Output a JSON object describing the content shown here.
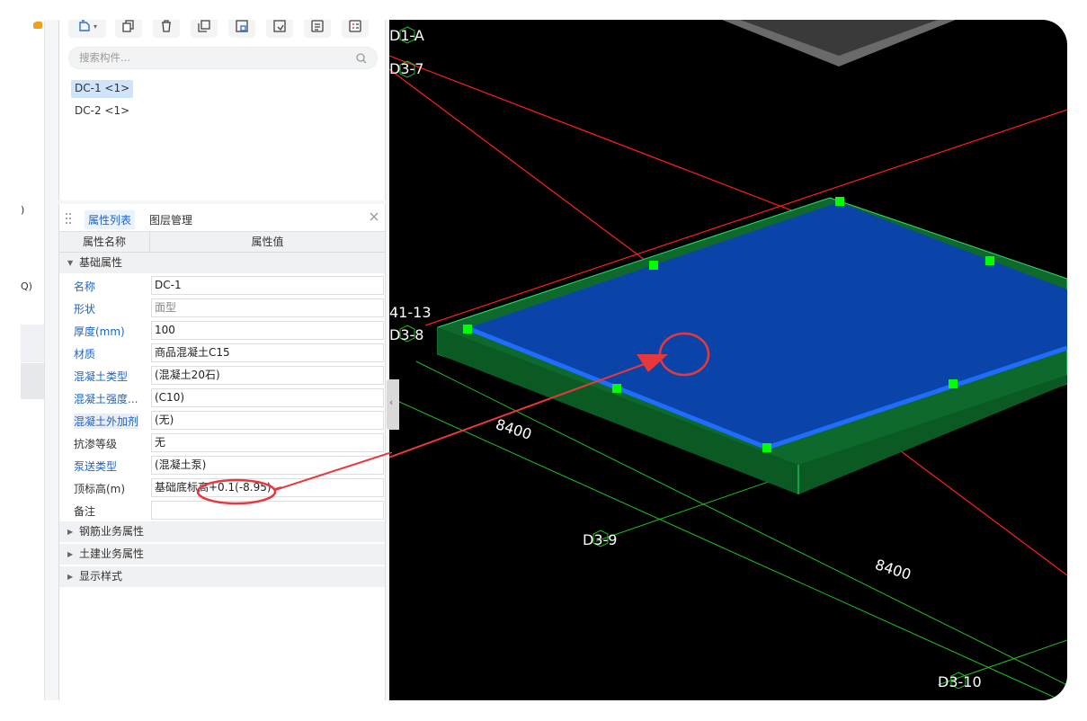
{
  "toolbar": {
    "buttons": [
      {
        "name": "new-component-icon"
      },
      {
        "name": "copy-icon"
      },
      {
        "name": "delete-icon"
      },
      {
        "name": "duplicate-icon"
      },
      {
        "name": "save-icon"
      },
      {
        "name": "export-icon"
      },
      {
        "name": "list-icon"
      },
      {
        "name": "checklist-icon"
      }
    ]
  },
  "search": {
    "placeholder": "搜索构件..."
  },
  "components": [
    {
      "label": "DC-1 <1>",
      "selected": true
    },
    {
      "label": "DC-2 <1>",
      "selected": false
    }
  ],
  "left_fragments": [
    ")",
    "Q)"
  ],
  "property_panel": {
    "tabs": [
      "属性列表",
      "图层管理"
    ],
    "header": {
      "name_col": "属性名称",
      "value_col": "属性值"
    },
    "group_basic": "基础属性",
    "rows": [
      {
        "name": "名称",
        "value": "DC-1"
      },
      {
        "name": "形状",
        "value": "面型"
      },
      {
        "name": "厚度(mm)",
        "value": "100"
      },
      {
        "name": "材质",
        "value": "商品混凝土C15"
      },
      {
        "name": "混凝土类型",
        "value": "(混凝土20石)"
      },
      {
        "name": "混凝土强度...",
        "value": "(C10)"
      },
      {
        "name": "混凝土外加剂",
        "value": "(无)"
      },
      {
        "name": "抗渗等级",
        "value": "无"
      },
      {
        "name": "泵送类型",
        "value": "(混凝土泵)"
      },
      {
        "name": "顶标高(m)",
        "value": "基础底标高+0.1(-8.95)"
      },
      {
        "name": "备注",
        "value": ""
      }
    ],
    "groups_collapsed": [
      "钢筋业务属性",
      "土建业务属性",
      "显示样式"
    ]
  },
  "viewport": {
    "axis_labels": [
      "D1-A",
      "D3-7",
      "41-13",
      "D3-8",
      "D3-9",
      "D3-10"
    ],
    "dimensions": [
      "8400",
      "8400"
    ],
    "colors": {
      "slab": "#0a44a8",
      "base": "#0d6a2c",
      "axis_red": "#ff2020",
      "axis_green": "#22c022",
      "grip": "#00ff00",
      "annotation": "#e8383d"
    }
  }
}
